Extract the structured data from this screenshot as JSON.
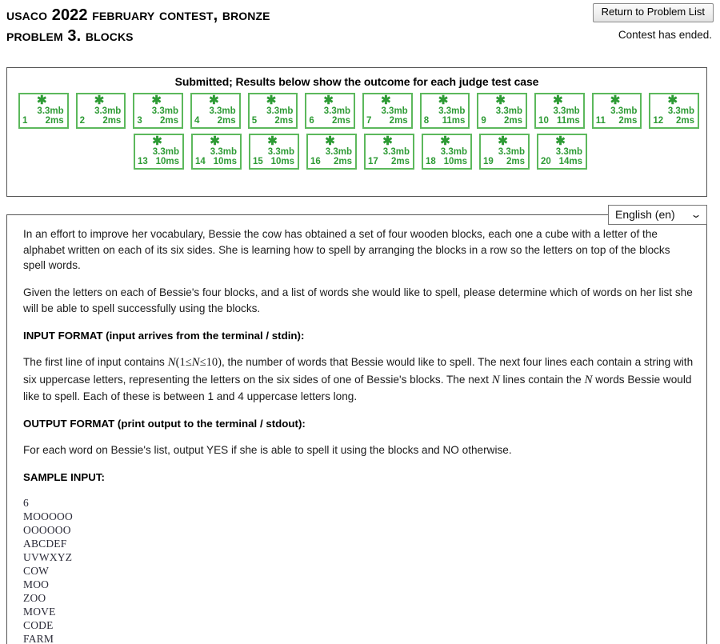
{
  "header": {
    "title_line1": "USACO 2022 February Contest, Bronze",
    "title_line2": "Problem 3. Blocks",
    "return_button": "Return to Problem List",
    "contest_status": "Contest has ended."
  },
  "results": {
    "heading": "Submitted; Results below show the outcome for each judge test case",
    "pass_symbol": "✱",
    "pass_color": "#5cb85c",
    "text_color": "#2e9b35",
    "row1": [
      {
        "num": "1",
        "mem": "3.3mb",
        "time": "2ms",
        "status": "pass"
      },
      {
        "num": "2",
        "mem": "3.3mb",
        "time": "2ms",
        "status": "pass"
      },
      {
        "num": "3",
        "mem": "3.3mb",
        "time": "2ms",
        "status": "pass"
      },
      {
        "num": "4",
        "mem": "3.3mb",
        "time": "2ms",
        "status": "pass"
      },
      {
        "num": "5",
        "mem": "3.3mb",
        "time": "2ms",
        "status": "pass"
      },
      {
        "num": "6",
        "mem": "3.3mb",
        "time": "2ms",
        "status": "pass"
      },
      {
        "num": "7",
        "mem": "3.3mb",
        "time": "2ms",
        "status": "pass"
      },
      {
        "num": "8",
        "mem": "3.3mb",
        "time": "11ms",
        "status": "pass"
      },
      {
        "num": "9",
        "mem": "3.3mb",
        "time": "2ms",
        "status": "pass"
      },
      {
        "num": "10",
        "mem": "3.3mb",
        "time": "11ms",
        "status": "pass"
      },
      {
        "num": "11",
        "mem": "3.3mb",
        "time": "2ms",
        "status": "pass"
      },
      {
        "num": "12",
        "mem": "3.3mb",
        "time": "2ms",
        "status": "pass"
      }
    ],
    "row2": [
      {
        "num": "13",
        "mem": "3.3mb",
        "time": "10ms",
        "status": "pass"
      },
      {
        "num": "14",
        "mem": "3.3mb",
        "time": "10ms",
        "status": "pass"
      },
      {
        "num": "15",
        "mem": "3.3mb",
        "time": "10ms",
        "status": "pass"
      },
      {
        "num": "16",
        "mem": "3.3mb",
        "time": "2ms",
        "status": "pass"
      },
      {
        "num": "17",
        "mem": "3.3mb",
        "time": "2ms",
        "status": "pass"
      },
      {
        "num": "18",
        "mem": "3.3mb",
        "time": "10ms",
        "status": "pass"
      },
      {
        "num": "19",
        "mem": "3.3mb",
        "time": "2ms",
        "status": "pass"
      },
      {
        "num": "20",
        "mem": "3.3mb",
        "time": "14ms",
        "status": "pass"
      }
    ]
  },
  "language": {
    "selected": "English (en)",
    "chevron": "⌄"
  },
  "problem": {
    "para1": "In an effort to improve her vocabulary, Bessie the cow has obtained a set of four wooden blocks, each one a cube with a letter of the alphabet written on each of its six sides. She is learning how to spell by arranging the blocks in a row so the letters on top of the blocks spell words.",
    "para2": "Given the letters on each of Bessie's four blocks, and a list of words she would like to spell, please determine which of words on her list she will be able to spell successfully using the blocks.",
    "input_format_heading": "INPUT FORMAT (input arrives from the terminal / stdin):",
    "input_part1": "The first line of input contains ",
    "input_var1": "N",
    "input_constraint_open": "(1",
    "input_le1": "≤",
    "input_var2": "N",
    "input_le2": "≤",
    "input_max": "10)",
    "input_part2": ", the number of words that Bessie would like to spell. The next four lines each contain a string with six uppercase letters, representing the letters on the six sides of one of Bessie's blocks. The next ",
    "input_var3": "N",
    "input_part3": " lines contain the ",
    "input_var4": "N",
    "input_part4": " words Bessie would like to spell. Each of these is between 1 and 4 uppercase letters long.",
    "output_format_heading": "OUTPUT FORMAT (print output to the terminal / stdout):",
    "output_text": "For each word on Bessie's list, output YES if she is able to spell it using the blocks and NO otherwise.",
    "sample_input_heading": "SAMPLE INPUT:",
    "sample_input": "6\nMOOOOO\nOOOOOO\nABCDEF\nUVWXYZ\nCOW\nMOO\nZOO\nMOVE\nCODE\nFARM"
  }
}
